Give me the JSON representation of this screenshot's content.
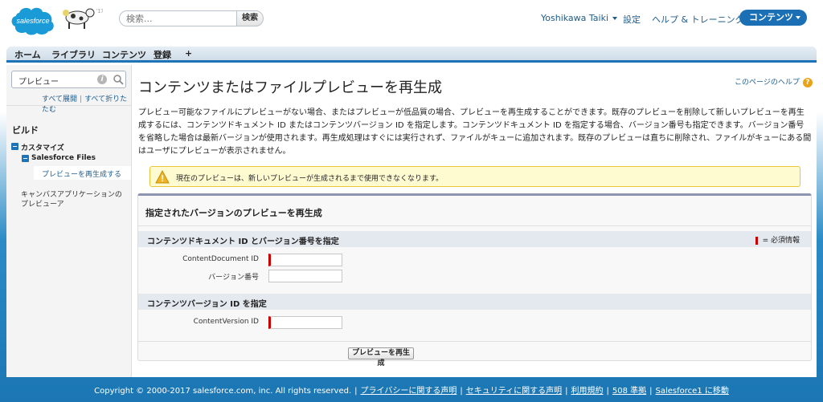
{
  "header": {
    "search_placeholder": "検索...",
    "search_button": "検索",
    "user_name": "Yoshikawa Taiki",
    "setup_link": "設定",
    "help_link": "ヘルプ & トレーニング",
    "app_menu": "コンテンツ"
  },
  "tabs": [
    "ホーム",
    "ライブラリ",
    "コンテンツ",
    "登録",
    "+"
  ],
  "sidebar": {
    "quick_find_value": "プレビュー",
    "expand_all": "すべて展開",
    "collapse_all": "すべて折りたたむ",
    "build_label": "ビルド",
    "customize_label": "カスタマイズ",
    "salesforce_files_label": "Salesforce Files",
    "selected_item": "プレビューを再生成する",
    "canvas_link": "キャンバスアプリケーションのプレビューア"
  },
  "main": {
    "title": "コンテンツまたはファイルプレビューを再生成",
    "help_text": "このページのヘルプ",
    "description": "プレビュー可能なファイルにプレビューがない場合、またはプレビューが低品質の場合、プレビューを再生成することができます。既存のプレビューを削除して新しいプレビューを再生成するには、コンテンツドキュメント ID またはコンテンツバージョン ID を指定します。コンテンツドキュメント ID を指定する場合、バージョン番号も指定できます。バージョン番号を省略した場合は最新バージョンが使用されます。再生成処理はすぐには実行されず、ファイルがキューに追加されます。既存のプレビューは直ちに削除され、ファイルがキューにある間はユーザにプレビューが表示されません。",
    "warning": "現在のプレビューは、新しいプレビューが生成されるまで使用できなくなります。",
    "panel_title": "指定されたバージョンのプレビューを再生成",
    "section1_title": "コンテンツドキュメント ID とバージョン番号を指定",
    "required_legend": "= 必須情報",
    "field_content_document_id": "ContentDocument ID",
    "field_version_number": "バージョン番号",
    "section2_title": "コンテンツバージョン ID を指定",
    "field_content_version_id": "ContentVersion ID",
    "regenerate_button": "プレビューを再生成"
  },
  "footer": {
    "copyright": "Copyright © 2000-2017 salesforce.com, inc. All rights reserved.",
    "links": [
      "プライバシーに関する声明",
      "セキュリティに関する声明",
      "利用規約",
      "508 準拠",
      "Salesforce1 に移動"
    ]
  },
  "colors": {
    "brand_blue": "#1b76b3",
    "link_blue": "#1e5c8c",
    "required_red": "#cc0000",
    "warning_bg": "#fffbd0"
  }
}
